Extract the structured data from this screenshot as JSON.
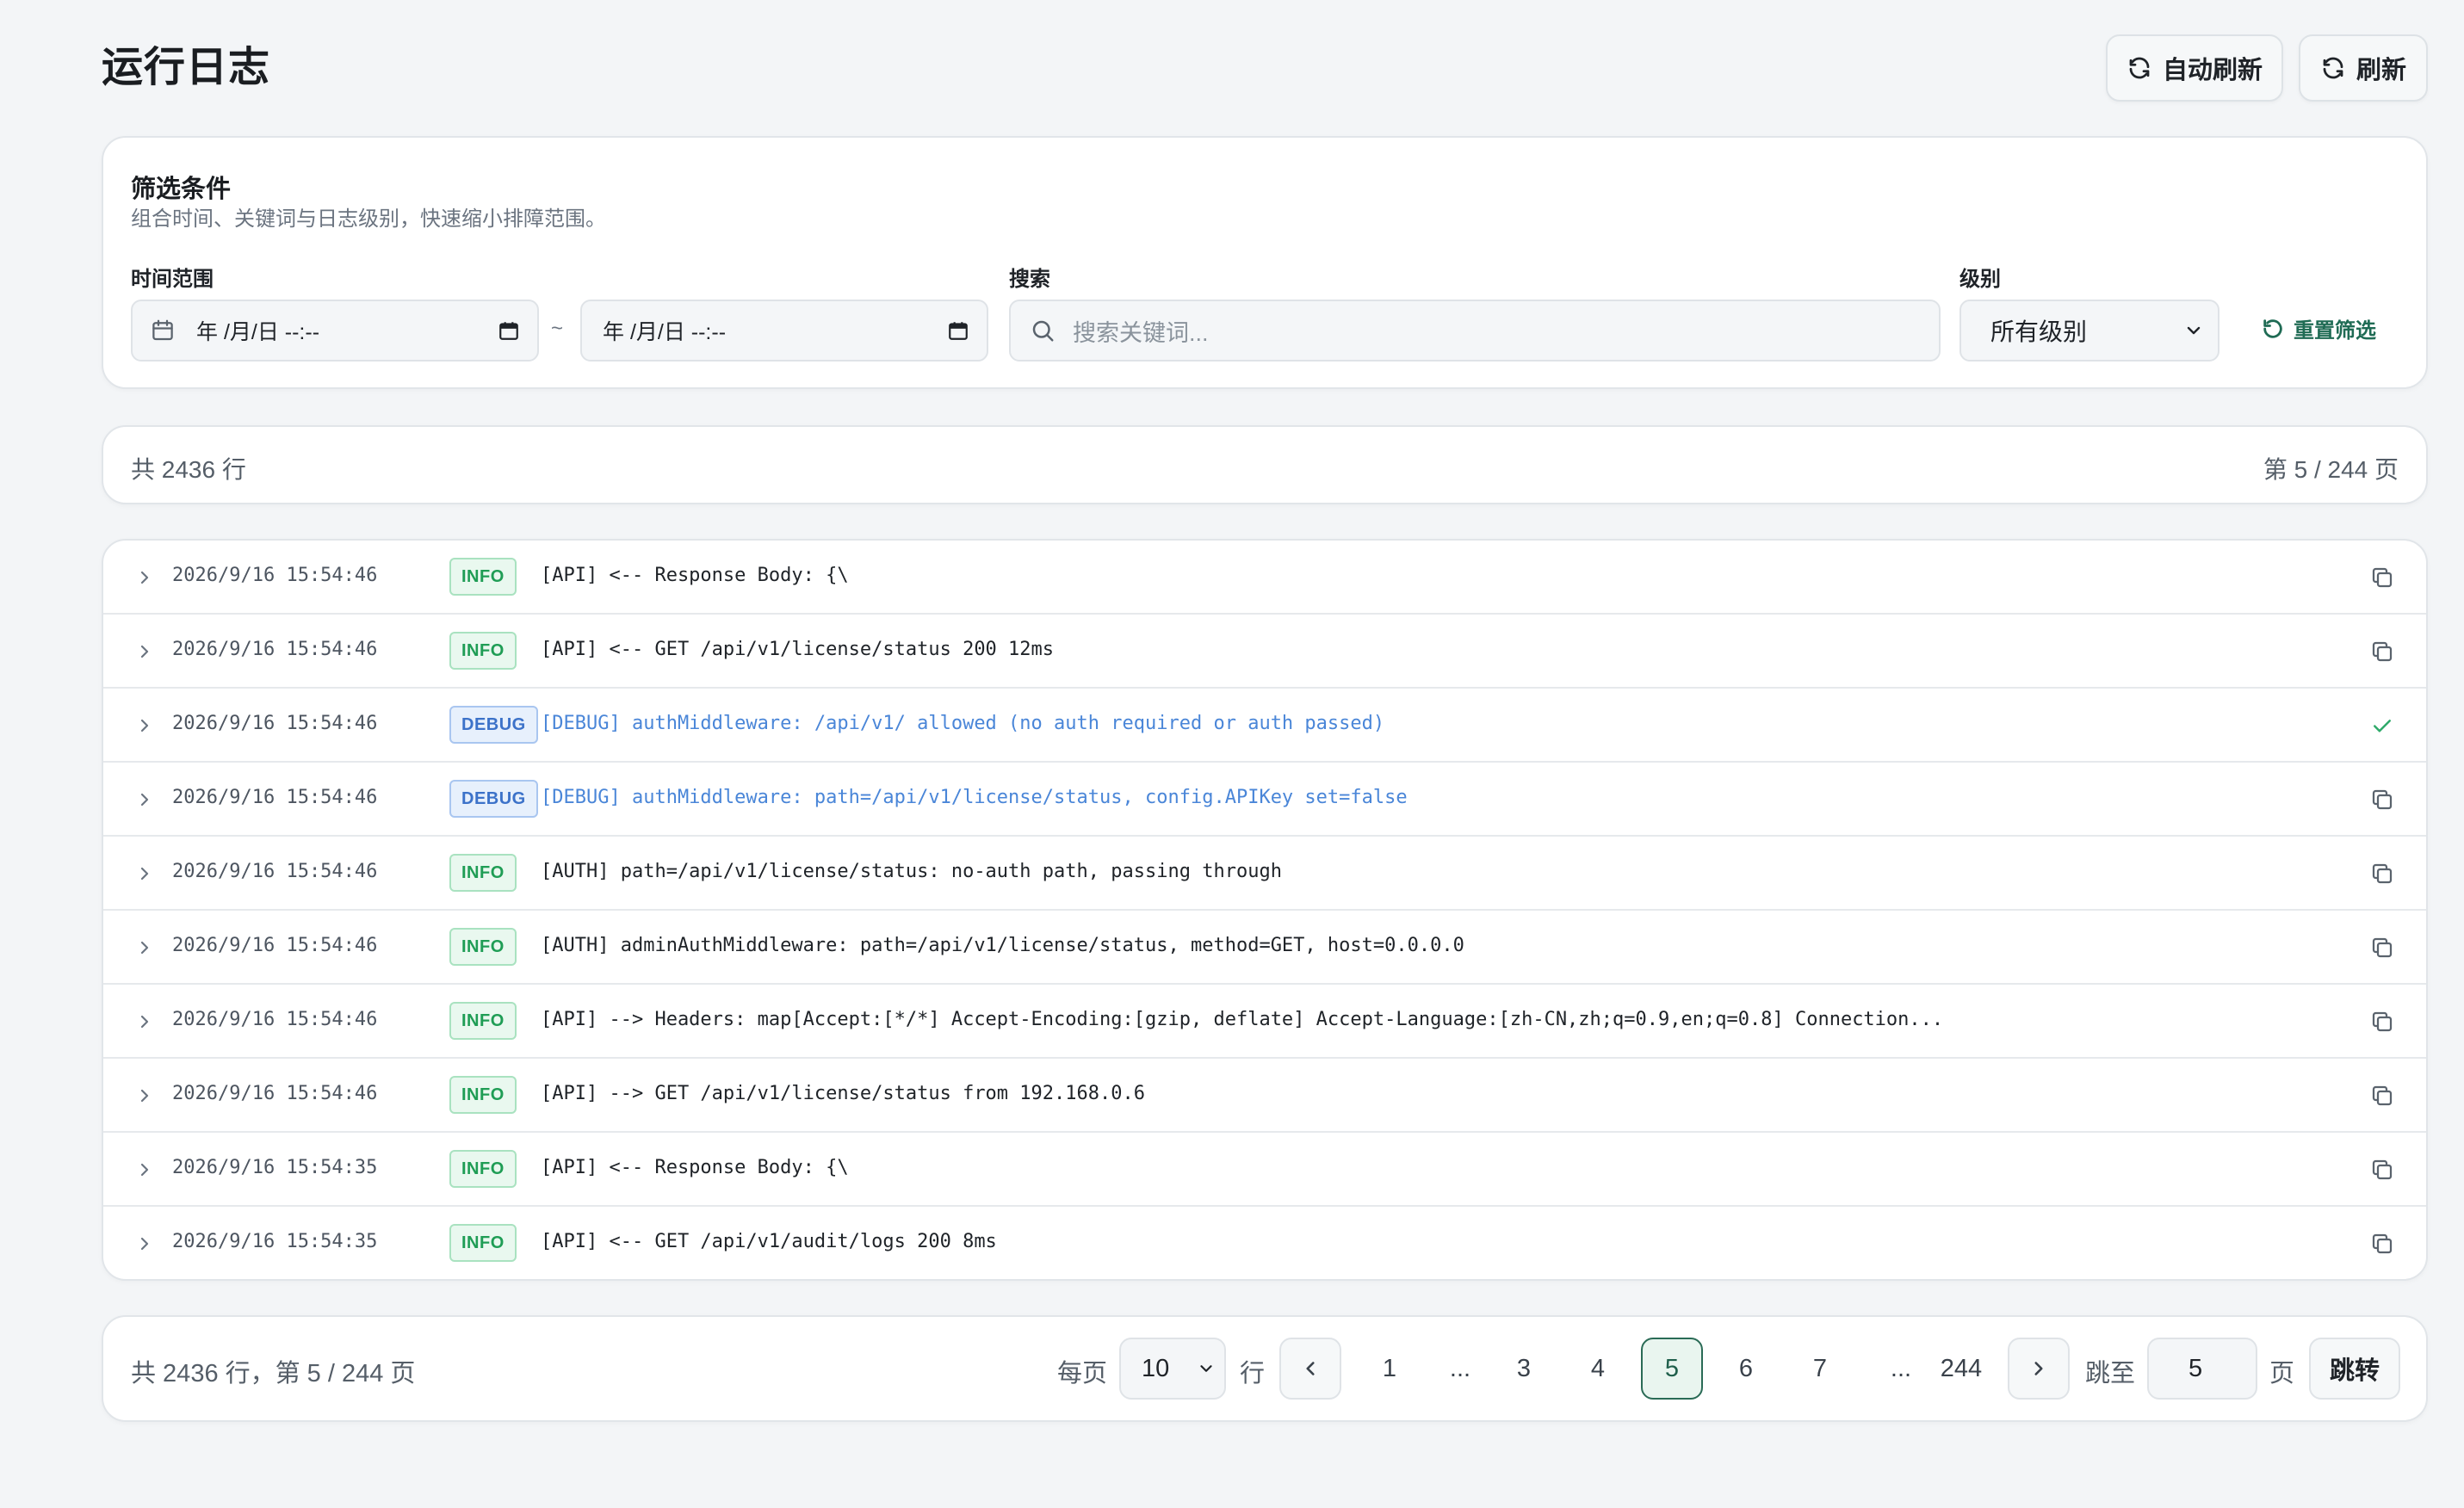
{
  "header": {
    "title": "运行日志",
    "auto_refresh_label": "自动刷新",
    "refresh_label": "刷新"
  },
  "filters": {
    "title": "筛选条件",
    "subtitle": "组合时间、关键词与日志级别，快速缩小排障范围。",
    "time_range_label": "时间范围",
    "start_value": "年 /月/日 --:--",
    "separator": "~",
    "end_value": "年 /月/日 --:--",
    "search_label": "搜索",
    "search_placeholder": "搜索关键词...",
    "level_label": "级别",
    "level_selected": "所有级别",
    "reset_label": "重置筛选"
  },
  "summary": {
    "total_rows": "共 2436 行",
    "page_info": "第 5 / 244 页"
  },
  "logs": [
    {
      "timestamp": "2026/9/16 15:54:46",
      "level": "INFO",
      "message": "[API] <-- Response Body: {\\",
      "action": "copy"
    },
    {
      "timestamp": "2026/9/16 15:54:46",
      "level": "INFO",
      "message": "[API] <-- GET /api/v1/license/status 200 12ms",
      "action": "copy"
    },
    {
      "timestamp": "2026/9/16 15:54:46",
      "level": "DEBUG",
      "message": "[DEBUG] authMiddleware: /api/v1/ allowed (no auth required or auth passed)",
      "action": "copied"
    },
    {
      "timestamp": "2026/9/16 15:54:46",
      "level": "DEBUG",
      "message": "[DEBUG] authMiddleware: path=/api/v1/license/status, config.APIKey set=false",
      "action": "copy"
    },
    {
      "timestamp": "2026/9/16 15:54:46",
      "level": "INFO",
      "message": "[AUTH] path=/api/v1/license/status: no-auth path, passing through",
      "action": "copy"
    },
    {
      "timestamp": "2026/9/16 15:54:46",
      "level": "INFO",
      "message": "[AUTH] adminAuthMiddleware: path=/api/v1/license/status, method=GET, host=0.0.0.0",
      "action": "copy"
    },
    {
      "timestamp": "2026/9/16 15:54:46",
      "level": "INFO",
      "message": "[API] --> Headers: map[Accept:[*/*] Accept-Encoding:[gzip, deflate] Accept-Language:[zh-CN,zh;q=0.9,en;q=0.8] Connection...",
      "action": "copy"
    },
    {
      "timestamp": "2026/9/16 15:54:46",
      "level": "INFO",
      "message": "[API] --> GET /api/v1/license/status from 192.168.0.6",
      "action": "copy"
    },
    {
      "timestamp": "2026/9/16 15:54:35",
      "level": "INFO",
      "message": "[API] <-- Response Body: {\\",
      "action": "copy"
    },
    {
      "timestamp": "2026/9/16 15:54:35",
      "level": "INFO",
      "message": "[API] <-- GET /api/v1/audit/logs 200 8ms",
      "action": "copy"
    }
  ],
  "pager": {
    "summary": "共 2436 行，第 5 / 244 页",
    "per_page_label": "每页",
    "per_page_value": "10",
    "rows_unit": "行",
    "pages": [
      "1",
      "...",
      "3",
      "4",
      "5",
      "6",
      "7",
      "...",
      "244"
    ],
    "current_page": "5",
    "jump_label": "跳至",
    "jump_value": "5",
    "page_unit": "页",
    "jump_button": "跳转"
  },
  "colors": {
    "accent": "#1f6b54",
    "info_badge": "#1f9d55",
    "debug_badge": "#3c72c9",
    "background": "#f3f5f7"
  }
}
